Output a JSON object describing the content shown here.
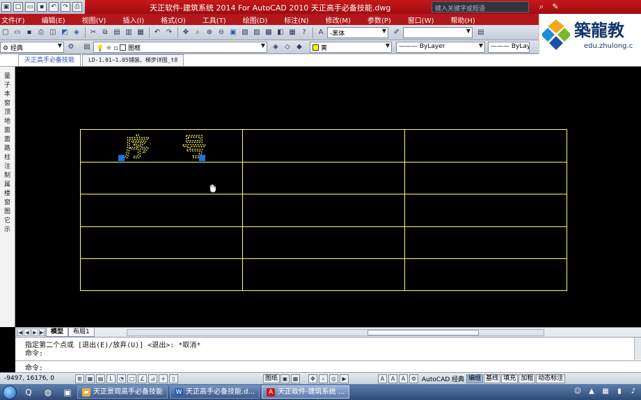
{
  "titlebar": {
    "title": "天正软件-建筑系统 2014  For AutoCAD 2010    天正高手必备技能.dwg",
    "search_placeholder": "键入关键字或短语"
  },
  "menu": [
    "文件(F)",
    "编辑(E)",
    "视图(V)",
    "插入(I)",
    "格式(O)",
    "工具(T)",
    "绘图(D)",
    "标注(N)",
    "修改(M)",
    "参数(P)",
    "窗口(W)",
    "帮助(H)"
  ],
  "toolbar": {
    "text_style": "-黑体",
    "workspace": "经典",
    "layer": "图框",
    "color": "黄",
    "color_hex": "#ffff00",
    "linetype": "ByLayer",
    "lineweight": "ByLayer"
  },
  "logo": {
    "text": "築龍教",
    "url": "edu.zhulong.c"
  },
  "tabs": {
    "tab1": "天正高手必备技能",
    "tab2": "LD-1.01~1.05铺装、梯步详图_t8"
  },
  "left_palette": [
    "量",
    "子",
    "本",
    "窗",
    "顶",
    "地",
    "面",
    "面",
    "路",
    "柱",
    "注",
    "制",
    "属",
    "楼",
    "窗",
    "图",
    "它",
    "示"
  ],
  "drawing": {
    "cell_text_1": "序",
    "cell_text_2": "号",
    "line_color": "#ffff66"
  },
  "layout_tabs": {
    "model": "模型",
    "layout1": "布局1"
  },
  "command": {
    "line1": "指定第二个点或 [退出(E)/放弃(U)] <退出>:  *取消*",
    "line2": "命令:",
    "prompt": "命令:"
  },
  "status": {
    "coords": "-9497, 16176, 0",
    "paper": "图纸",
    "workspace_label": "AutoCAD 经典",
    "buttons": [
      "编组",
      "基线",
      "填充",
      "加粗",
      "动态标注"
    ]
  },
  "taskbar": {
    "items": [
      {
        "label": "天正景观高手必备技能",
        "icon": "folder-icon"
      },
      {
        "label": "天正高手必备技能.d...",
        "icon": "word-icon"
      },
      {
        "label": "天正软件-建筑系统 ...",
        "icon": "autocad-icon"
      }
    ]
  }
}
